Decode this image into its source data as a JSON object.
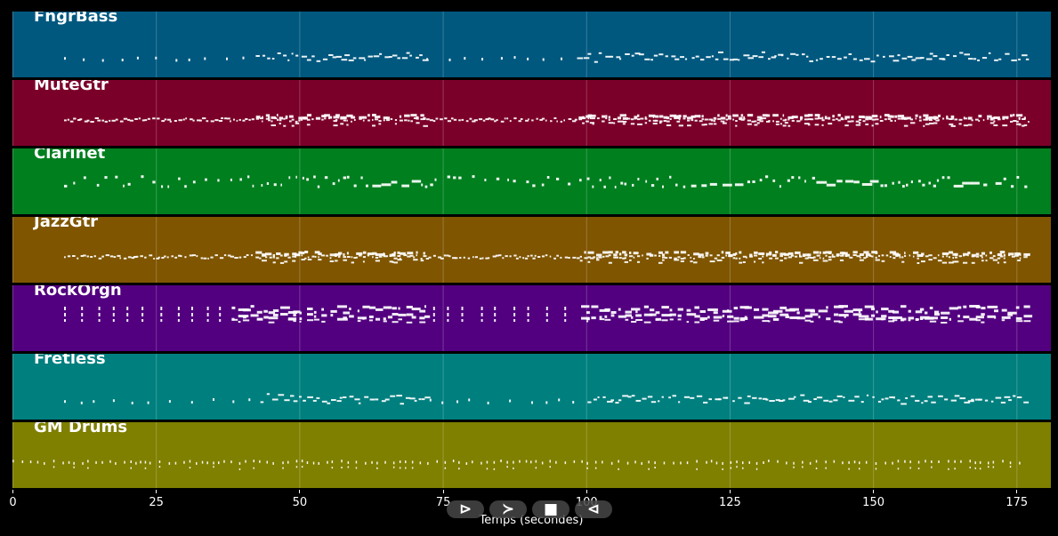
{
  "chart_data": {
    "type": "piano-roll",
    "x_unit": "seconds",
    "xlim": [
      0,
      181
    ],
    "xlabel": "Temps (secondes)",
    "x_ticks": [
      0,
      25,
      50,
      75,
      100,
      125,
      150,
      175
    ],
    "grid": true,
    "tracks": [
      {
        "name": "FngrBass",
        "color": "#00587f",
        "note_start": 9,
        "note_end": 177,
        "note_style": "sparse-bass"
      },
      {
        "name": "MuteGtr",
        "color": "#7b0029",
        "note_start": 9,
        "note_end": 177,
        "note_style": "dense-chords"
      },
      {
        "name": "Clarinet",
        "color": "#007f1f",
        "note_start": 9,
        "note_end": 177,
        "note_style": "melody"
      },
      {
        "name": "JazzGtr",
        "color": "#7f5500",
        "note_start": 9,
        "note_end": 177,
        "note_style": "dense-chords"
      },
      {
        "name": "RockOrgn",
        "color": "#52007f",
        "note_start": 9,
        "note_end": 177,
        "note_style": "organ-chords"
      },
      {
        "name": "Fretless",
        "color": "#007f7f",
        "note_start": 9,
        "note_end": 177,
        "note_style": "sparse-bass"
      },
      {
        "name": "GM Drums",
        "color": "#7f7f00",
        "note_start": 0,
        "note_end": 176,
        "note_style": "drums"
      }
    ]
  },
  "transport": {
    "buttons": [
      {
        "name": "play-button",
        "glyph": "⊳"
      },
      {
        "name": "fast-forward-button",
        "glyph": "≻"
      },
      {
        "name": "stop-button",
        "glyph": "■"
      },
      {
        "name": "rewind-button",
        "glyph": "⊲"
      }
    ]
  }
}
